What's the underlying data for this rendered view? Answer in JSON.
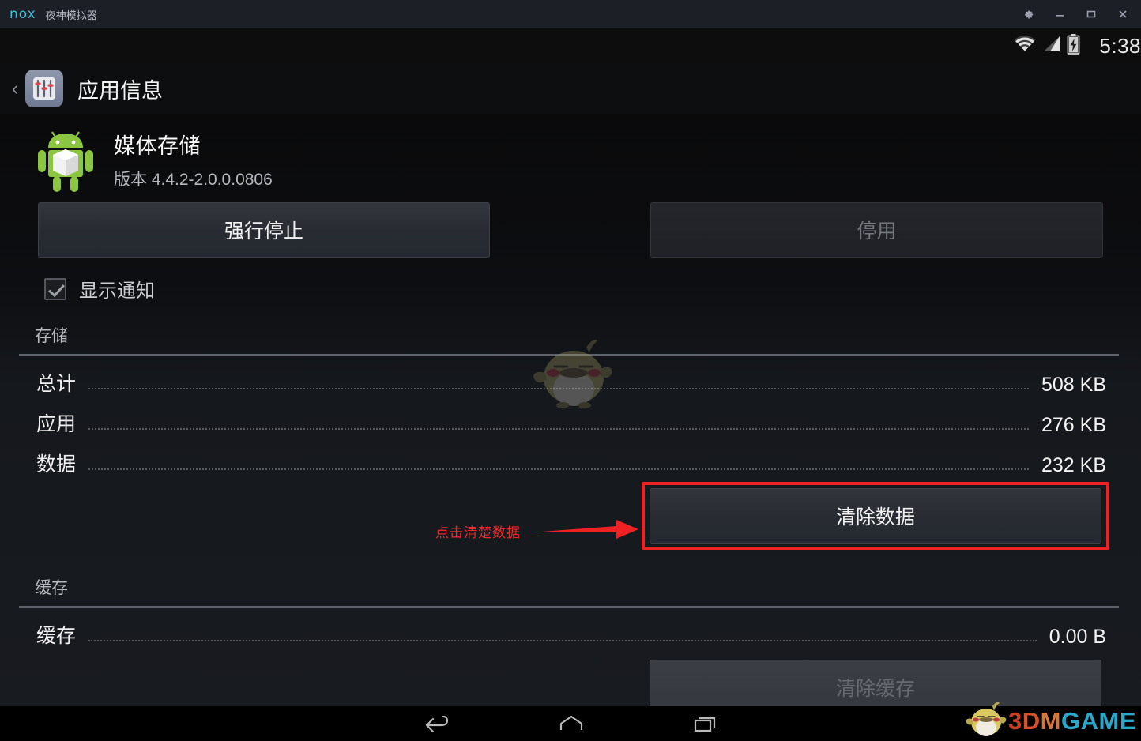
{
  "window": {
    "brand": "nox",
    "title": "夜神模拟器",
    "controls": [
      {
        "name": "settings-gear",
        "label": "⚙"
      },
      {
        "name": "minimize",
        "label": "—"
      },
      {
        "name": "maximize",
        "label": "▢"
      },
      {
        "name": "close",
        "label": "✕"
      }
    ]
  },
  "statusbar": {
    "time": "5:38",
    "icons": [
      "wifi-icon",
      "signal-icon",
      "battery-charging-icon"
    ]
  },
  "actionbar": {
    "back": "‹",
    "icon": "settings-sliders-icon",
    "title": "应用信息"
  },
  "app": {
    "icon": "android-robot-icon",
    "name": "媒体存储",
    "version": "版本 4.4.2-2.0.0.0806"
  },
  "buttons": {
    "force_stop": "强行停止",
    "disable": "停用",
    "clear_data": "清除数据",
    "clear_cache": "清除缓存"
  },
  "checkbox": {
    "label": "显示通知",
    "checked": "true"
  },
  "storage_section": {
    "title": "存储",
    "rows": [
      {
        "label": "总计",
        "value": "508 KB"
      },
      {
        "label": "应用",
        "value": "276 KB"
      },
      {
        "label": "数据",
        "value": "232 KB"
      }
    ]
  },
  "cache_section": {
    "title": "缓存",
    "rows": [
      {
        "label": "缓存",
        "value": "0.00 B"
      }
    ]
  },
  "annotation": {
    "text": "点击清楚数据",
    "color": "#ee2b2b",
    "highlight_color": "#ee2222"
  },
  "navbar": {
    "back": "back-icon",
    "home": "home-icon",
    "recents": "recents-icon"
  },
  "watermark": {
    "center": "bird-mascot-icon",
    "brand_1": "3",
    "brand_2": "D",
    "brand_3": "M",
    "brand_4": "GAME"
  }
}
